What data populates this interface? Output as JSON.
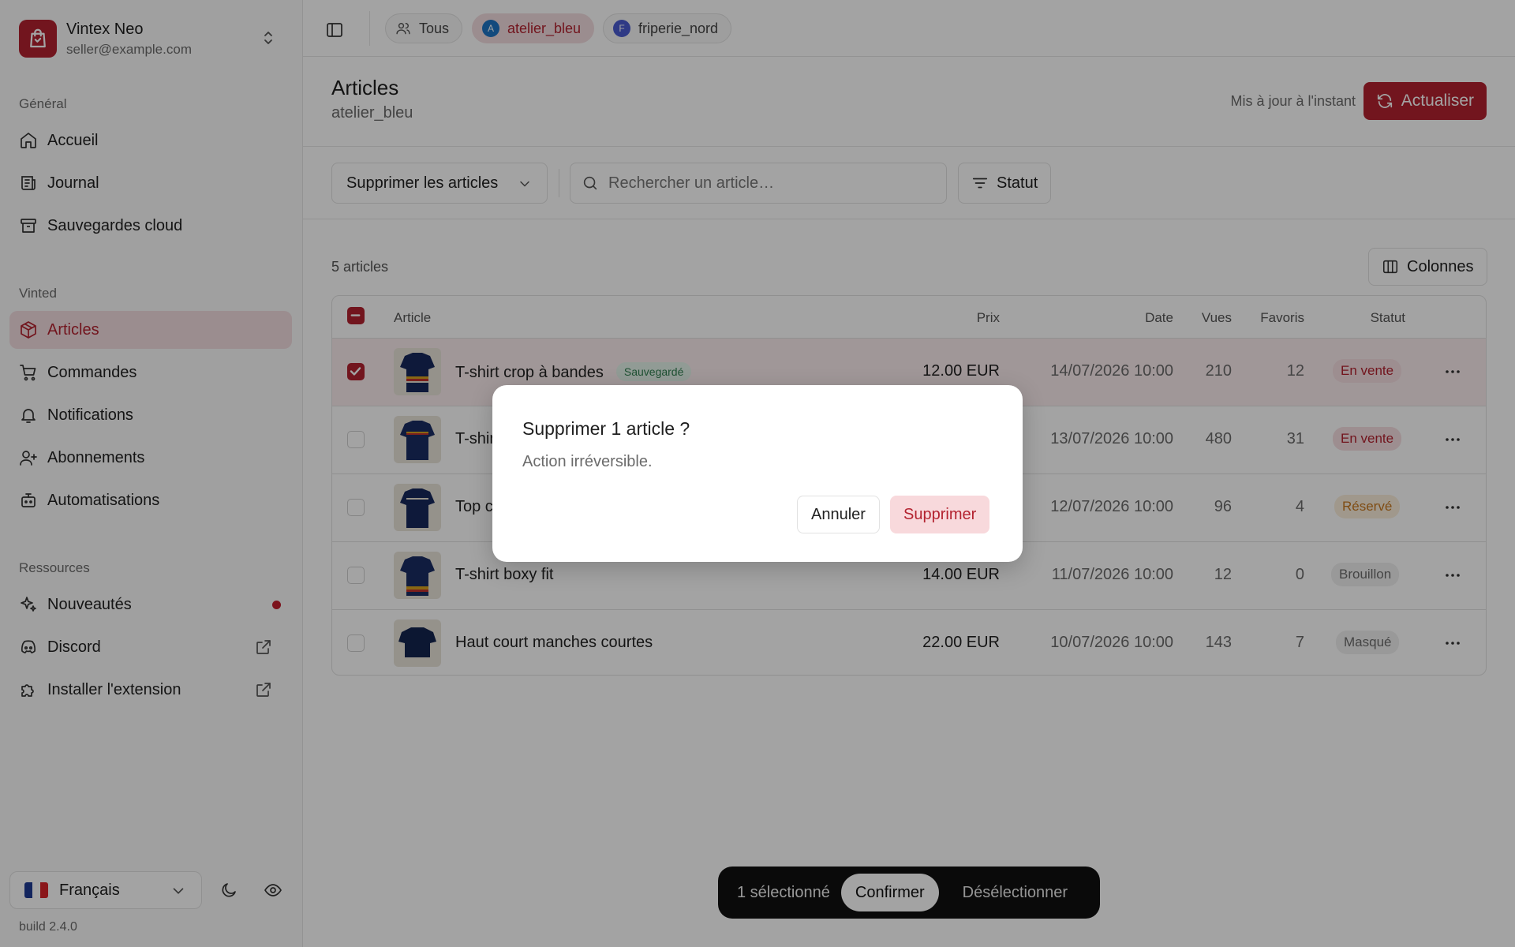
{
  "app": {
    "name": "Vintex Neo",
    "email": "seller@example.com",
    "build": "build 2.4.0",
    "accent": "#b3222f"
  },
  "sidebar": {
    "groups": [
      {
        "label": "Général",
        "items": [
          {
            "label": "Accueil",
            "icon": "home-icon"
          },
          {
            "label": "Journal",
            "icon": "journal-icon"
          },
          {
            "label": "Sauvegardes cloud",
            "icon": "archive-icon"
          }
        ]
      },
      {
        "label": "Vinted",
        "items": [
          {
            "label": "Articles",
            "icon": "package-icon",
            "active": true
          },
          {
            "label": "Commandes",
            "icon": "cart-icon"
          },
          {
            "label": "Notifications",
            "icon": "bell-icon"
          },
          {
            "label": "Abonnements",
            "icon": "user-plus-icon"
          },
          {
            "label": "Automatisations",
            "icon": "bot-icon"
          }
        ]
      },
      {
        "label": "Ressources",
        "items": [
          {
            "label": "Nouveautés",
            "icon": "sparkles-icon",
            "dot": true
          },
          {
            "label": "Discord",
            "icon": "discord-icon",
            "external": true
          },
          {
            "label": "Installer l'extension",
            "icon": "puzzle-icon",
            "external": true
          }
        ]
      }
    ],
    "language": "Français"
  },
  "topbar": {
    "accounts": [
      {
        "label": "Tous",
        "avatar": "",
        "color": ""
      },
      {
        "label": "atelier_bleu",
        "avatar": "A",
        "color": "#1e74c4",
        "active": true
      },
      {
        "label": "friperie_nord",
        "avatar": "F",
        "color": "#4a5bd1"
      }
    ]
  },
  "header": {
    "title": "Articles",
    "subtitle": "atelier_bleu",
    "updated": "Mis à jour à l'instant",
    "refresh_label": "Actualiser"
  },
  "toolbar": {
    "action": "Supprimer les articles",
    "search_placeholder": "Rechercher un article…",
    "status_label": "Statut",
    "columns_label": "Colonnes"
  },
  "table": {
    "count": "5 articles",
    "columns": [
      "Article",
      "Prix",
      "Date",
      "Vues",
      "Favoris",
      "Statut"
    ],
    "rows": [
      {
        "title": "T-shirt crop à bandes",
        "badge": "Sauvegardé",
        "price": "12.00 EUR",
        "date": "14/07/2026 10:00",
        "views": "210",
        "favs": "12",
        "status": "En vente",
        "status_kind": "sale",
        "selected": true
      },
      {
        "title": "T-shirt",
        "badge": "",
        "price": "",
        "date": "13/07/2026 10:00",
        "views": "480",
        "favs": "31",
        "status": "En vente",
        "status_kind": "sale",
        "selected": false
      },
      {
        "title": "Top c",
        "badge": "",
        "price": "",
        "date": "12/07/2026 10:00",
        "views": "96",
        "favs": "4",
        "status": "Réservé",
        "status_kind": "res",
        "selected": false
      },
      {
        "title": "T-shirt boxy fit",
        "badge": "",
        "price": "14.00 EUR",
        "date": "11/07/2026 10:00",
        "views": "12",
        "favs": "0",
        "status": "Brouillon",
        "status_kind": "muted",
        "selected": false
      },
      {
        "title": "Haut court manches courtes",
        "badge": "",
        "price": "22.00 EUR",
        "date": "10/07/2026 10:00",
        "views": "143",
        "favs": "7",
        "status": "Masqué",
        "status_kind": "muted",
        "selected": false
      }
    ]
  },
  "bulkbar": {
    "selected": "1 sélectionné",
    "confirm": "Confirmer",
    "deselect": "Désélectionner"
  },
  "modal": {
    "title": "Supprimer 1 article ?",
    "description": "Action irréversible.",
    "cancel": "Annuler",
    "confirm": "Supprimer"
  }
}
